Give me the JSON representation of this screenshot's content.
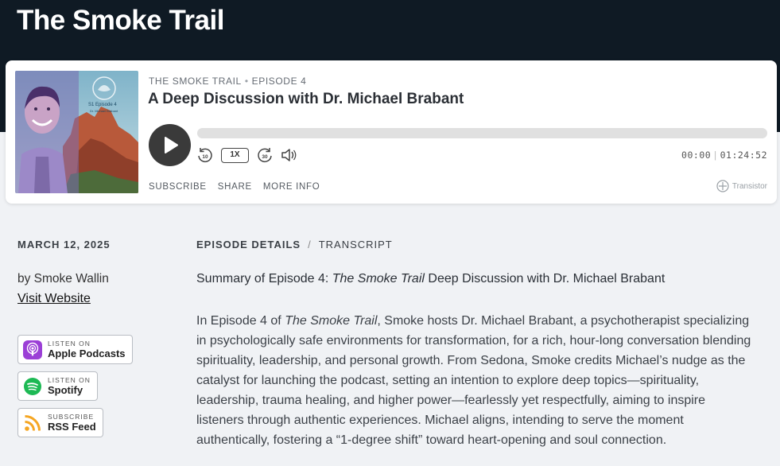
{
  "site": {
    "title": "The Smoke Trail"
  },
  "player": {
    "show_name": "THE SMOKE TRAIL",
    "episode_label": "EPISODE 4",
    "episode_title": "A Deep Discussion with Dr. Michael Brabant",
    "cover": {
      "text_line1": "S1 Episode 4",
      "text_line2": "Dr. Michael Brabant"
    },
    "progress_fraction": 0.0,
    "speed": "1X",
    "time_current": "00:00",
    "time_total": "01:24:52",
    "links": {
      "subscribe": "SUBSCRIBE",
      "share": "SHARE",
      "more_info": "MORE INFO"
    },
    "branding": "Transistor",
    "icons": [
      "play-icon",
      "rewind-10-icon",
      "forward-30-icon",
      "volume-icon",
      "transistor-logo-icon"
    ]
  },
  "sidebar": {
    "date": "MARCH 12, 2025",
    "author": "by Smoke Wallin",
    "visit_link": "Visit Website",
    "badges": [
      {
        "small": "LISTEN ON",
        "big": "Apple Podcasts",
        "icon": "apple-podcasts-icon",
        "color": "#9b3fd6"
      },
      {
        "small": "LISTEN ON",
        "big": "Spotify",
        "icon": "spotify-icon",
        "color": "#1db954"
      },
      {
        "small": "SUBSCRIBE",
        "big": "RSS Feed",
        "icon": "rss-icon",
        "color": "#f5a623"
      }
    ]
  },
  "content": {
    "tab_details": "EPISODE DETAILS",
    "tab_separator": "/",
    "tab_transcript": "TRANSCRIPT",
    "summary_prefix": "Summary of Episode 4: ",
    "summary_italic": "The Smoke Trail",
    "summary_suffix": " Deep Discussion with Dr. Michael Brabant",
    "para_prefix": "In Episode 4 of ",
    "para_italic": "The Smoke Trail",
    "para_rest": ", Smoke hosts Dr. Michael Brabant, a psychotherapist specializing in psychologically safe environments for transformation, for a rich, hour-long conversation blending spirituality, leadership, and personal growth. From Sedona, Smoke credits Michael’s nudge as the catalyst for launching the podcast, setting an intention to explore deep topics—spirituality, leadership, trauma healing, and higher power—fearlessly yet respectfully, aiming to inspire listeners through authentic experiences. Michael aligns, intending to serve the moment authentically, fostering a “1-degree shift” toward heart-opening and soul connection."
  }
}
